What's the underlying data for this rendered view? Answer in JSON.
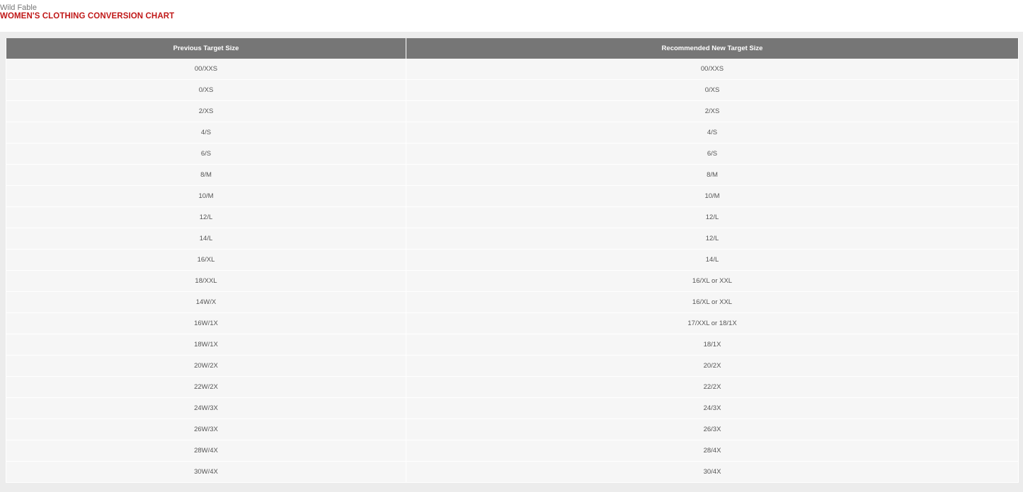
{
  "header": {
    "brand": "Wild Fable",
    "title": "WOMEN'S CLOTHING CONVERSION CHART"
  },
  "colors": {
    "title": "#c01818",
    "table_header_bg": "#767676",
    "row_bg": "#f6f6f6",
    "panel_bg": "#ececec"
  },
  "table": {
    "columns": [
      "Previous Target Size",
      "Recommended New Target Size"
    ],
    "rows": [
      [
        "00/XXS",
        "00/XXS"
      ],
      [
        "0/XS",
        "0/XS"
      ],
      [
        "2/XS",
        "2/XS"
      ],
      [
        "4/S",
        "4/S"
      ],
      [
        "6/S",
        "6/S"
      ],
      [
        "8/M",
        "8/M"
      ],
      [
        "10/M",
        "10/M"
      ],
      [
        "12/L",
        "12/L"
      ],
      [
        "14/L",
        "12/L"
      ],
      [
        "16/XL",
        "14/L"
      ],
      [
        "18/XXL",
        "16/XL or XXL"
      ],
      [
        "14W/X",
        "16/XL or XXL"
      ],
      [
        "16W/1X",
        "17/XXL or 18/1X"
      ],
      [
        "18W/1X",
        "18/1X"
      ],
      [
        "20W/2X",
        "20/2X"
      ],
      [
        "22W/2X",
        "22/2X"
      ],
      [
        "24W/3X",
        "24/3X"
      ],
      [
        "26W/3X",
        "26/3X"
      ],
      [
        "28W/4X",
        "28/4X"
      ],
      [
        "30W/4X",
        "30/4X"
      ]
    ]
  }
}
